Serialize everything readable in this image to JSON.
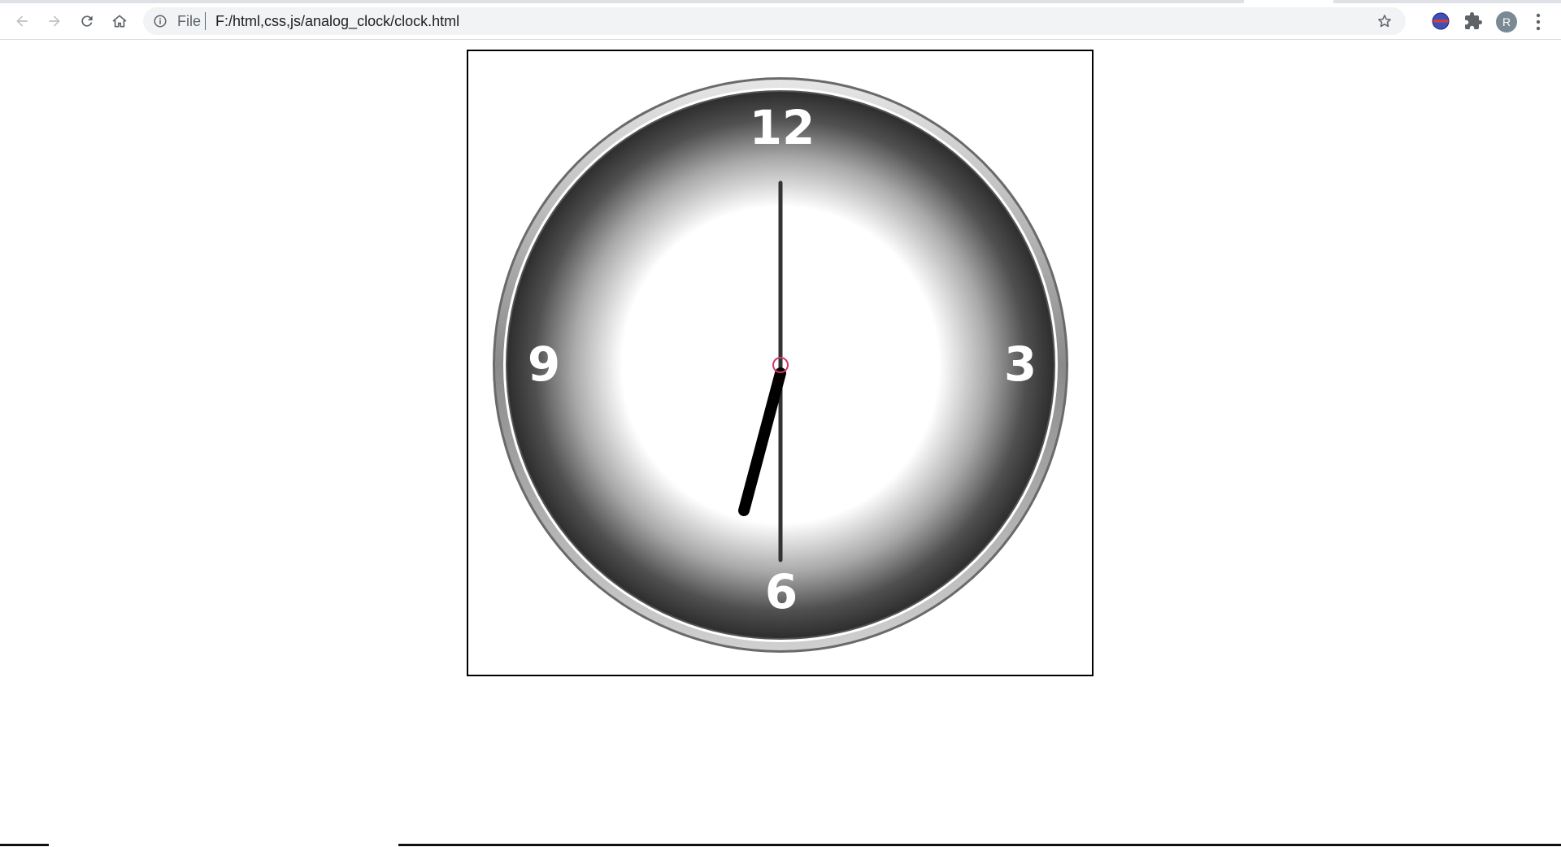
{
  "browser": {
    "scheme_label": "File",
    "url": "F:/html,css,js/analog_clock/clock.html",
    "profile_initial": "R",
    "icons": [
      "back-arrow-icon",
      "forward-arrow-icon",
      "reload-icon",
      "home-icon",
      "info-icon",
      "star-icon",
      "extension-globe-icon",
      "puzzle-icon",
      "kebab-menu-icon"
    ]
  },
  "clock": {
    "numerals": {
      "twelve": "12",
      "three": "3",
      "six": "6",
      "nine": "9"
    },
    "time": {
      "hour": 6,
      "minute": 30
    },
    "colors": {
      "hour_hand": "#000000",
      "minute_hand": "#333333",
      "center_ring": "#d6336c",
      "numeral": "#ffffff"
    }
  }
}
